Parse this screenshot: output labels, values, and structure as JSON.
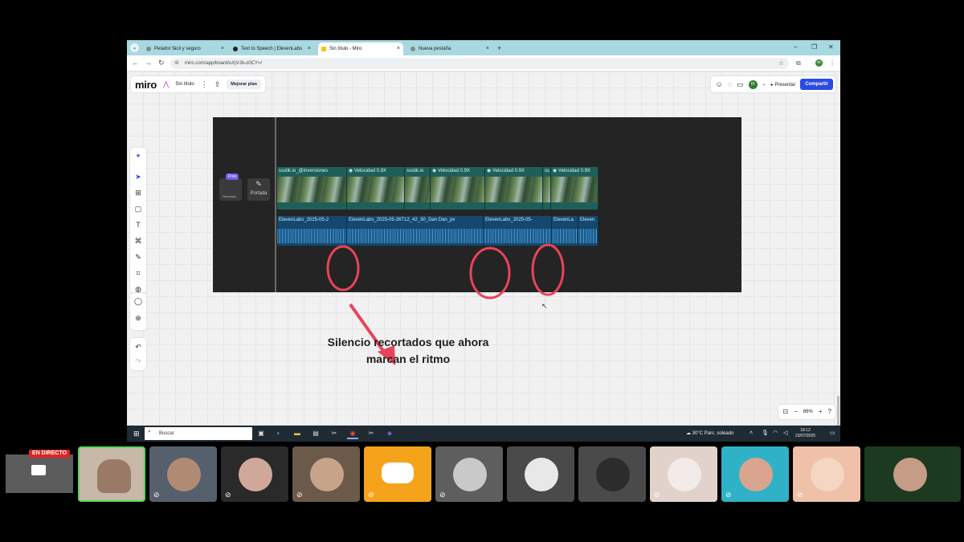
{
  "browser": {
    "tabs": [
      {
        "label": "Pelador fácil y seguro",
        "close": "×"
      },
      {
        "label": "Text to Speech | ElevenLabs",
        "close": "×"
      },
      {
        "label": "Sin título - Miro",
        "close": "×"
      },
      {
        "label": "Nueva pestaña",
        "close": "×"
      }
    ],
    "new_tab": "+",
    "url": "miro.com/app/board/uXjVJb-o0CY=/",
    "window_controls": [
      "–",
      "❐",
      "✕"
    ]
  },
  "miro": {
    "logo": "miro",
    "board_name": "Sin título",
    "upgrade": "Mejorar plan",
    "present": "Presentar",
    "share": "Compartir",
    "zoom_level": "86%",
    "avatar_initial": "m"
  },
  "editor": {
    "free_badge": "Free",
    "free_card_label": "Recortad...",
    "portada_label": "Portada",
    "video_clips": [
      "ssstik.io_@inversiones",
      "Velocidad 0.9X",
      "ssstik.io",
      "Velocidad 0.9X",
      "Velocidad 0.9X",
      "ss",
      "Velocidad 0.9X"
    ],
    "audio_clips": [
      "ElevenLabs_2025-05-2",
      "ElevenLabs_2025-05-26T12_42_30_Dan Dan_pv",
      "ElevenLabs_2025-05-",
      "ElevenLa",
      "Eleven"
    ]
  },
  "annotation": {
    "line1": "Silencio recortados que ahora",
    "line2": "marcan el ritmo"
  },
  "taskbar": {
    "search_placeholder": "Buscar",
    "weather": "30°C  Parc. soleado",
    "time": "18:12",
    "date": "23/07/2025"
  },
  "stream": {
    "live_badge": "EN DIRECTO"
  },
  "colors": {
    "share_button": "#2a4be3",
    "discord_tile": "#f5a31a",
    "live_badge": "#e02424",
    "annotation_arrow": "#e8445a"
  }
}
